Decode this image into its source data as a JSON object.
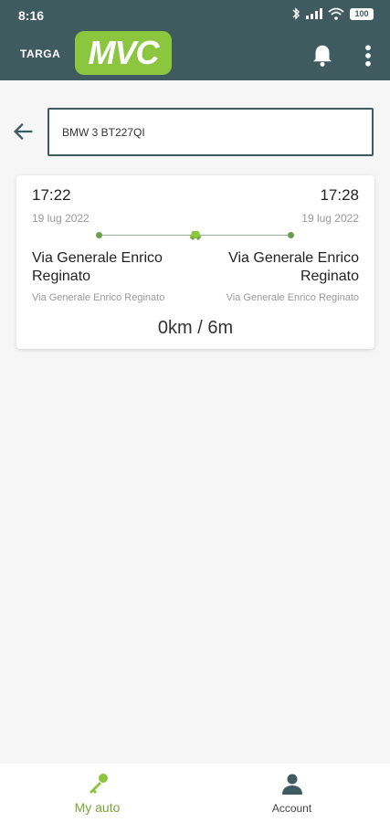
{
  "colors": {
    "topbar": "#3f5b60",
    "brand_green": "#8cc63f",
    "active_nav": "#7aa53b",
    "route_dot": "#6b9f4e"
  },
  "status_bar": {
    "time": "8:16",
    "battery": "100",
    "icons": [
      "bluetooth-icon",
      "signal-icon",
      "wifi-icon",
      "battery-icon"
    ]
  },
  "app_bar": {
    "logo_prefix": "TARGA",
    "logo_main": "MVC",
    "icons": [
      "bell-icon",
      "more-vert-icon"
    ]
  },
  "search": {
    "value": "BMW 3 BT227QI"
  },
  "trip": {
    "start_time": "17:22",
    "end_time": "17:28",
    "start_date": "19 lug 2022",
    "end_date": "19 lug 2022",
    "start_address": "Via Generale Enrico Reginato",
    "end_address": "Via Generale Enrico Reginato",
    "start_sub": "Via Generale Enrico Reginato",
    "end_sub": "Via Generale Enrico Reginato",
    "distance_duration": "0km / 6m"
  },
  "bottom_nav": {
    "items": [
      {
        "label": "My auto",
        "icon": "key-icon",
        "active": true
      },
      {
        "label": "Account",
        "icon": "person-icon",
        "active": false
      }
    ]
  }
}
